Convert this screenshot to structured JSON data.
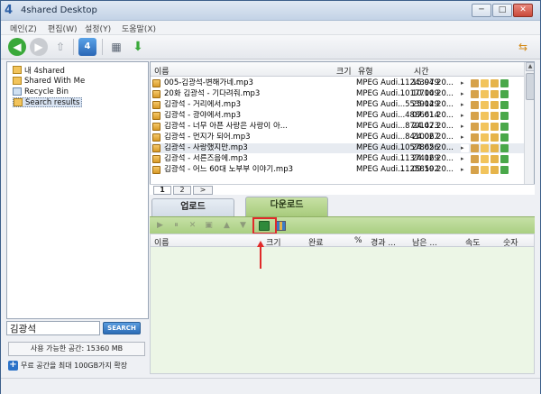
{
  "window": {
    "title": "4shared Desktop",
    "app_icon": "4",
    "controls": {
      "minimize": "─",
      "maximize": "□",
      "close": "✕"
    }
  },
  "menu": [
    "메인(Z)",
    "편집(W)",
    "설정(Y)",
    "도움말(X)"
  ],
  "toolbar": {
    "icons": [
      "back-icon",
      "forward-icon",
      "up-icon",
      "4shared-globe-icon",
      "view-icon",
      "download-arrow-icon",
      "sync-icon"
    ],
    "glyphs": {
      "back": "◀",
      "forward": "▶",
      "up": "⇧",
      "view": "▦",
      "download": "⬇",
      "sync": "⇆"
    }
  },
  "tree": {
    "items": [
      {
        "label": "내 4shared",
        "icon": "folder-icon"
      },
      {
        "label": "Shared With Me",
        "icon": "shared-folder-icon"
      },
      {
        "label": "Recycle Bin",
        "icon": "recycle-bin-icon"
      },
      {
        "label": "Search results",
        "icon": "search-results-icon",
        "selected": true
      }
    ]
  },
  "search": {
    "value": "김광석",
    "button_label": "SEARCH"
  },
  "storage": {
    "label": "사용 가능한 공간: 15360 MB"
  },
  "expand": {
    "label": "무료 공간을 최대 100GB가지 확장"
  },
  "results": {
    "columns": {
      "name": "이름",
      "size": "크기",
      "type": "유형",
      "time": "시간"
    },
    "rows": [
      {
        "name": "005-김광석-변해가네.mp3",
        "size": "11243979",
        "type": "MPEG Audi...",
        "time": "15.04.20..."
      },
      {
        "name": "20화 김광석 - 기다려줘.mp3",
        "size": "10177049",
        "type": "MPEG Audi...",
        "time": "10.10.20..."
      },
      {
        "name": "김광석 - 거리에서.mp3",
        "size": "5539129",
        "type": "MPEG Audi...",
        "time": "25.04.20..."
      },
      {
        "name": "김광석 - 광야에서.mp3",
        "size": "4886614",
        "type": "MPEG Audi...",
        "time": "07.01.20..."
      },
      {
        "name": "김광석 - 너무 아픈 사랑은 사랑이 아...",
        "size": "8701473",
        "type": "MPEG Audi...",
        "time": "24.02.20..."
      },
      {
        "name": "김광석 - 먼지가 되어.mp3",
        "size": "8410067",
        "type": "MPEG Audi...",
        "time": "24.02.20..."
      },
      {
        "name": "김광석 - 사랑했지만.mp3",
        "size": "10578656",
        "type": "MPEG Audi...",
        "time": "24.02.20...",
        "highlighted": true
      },
      {
        "name": "김광석 - 서른즈음에.mp3",
        "size": "11374169",
        "type": "MPEG Audi...",
        "time": "24.02.20..."
      },
      {
        "name": "김광석 - 어느 60대 노부부 이야기.mp3",
        "size": "11258592",
        "type": "MPEG Audi...",
        "time": "09.10.20..."
      }
    ],
    "action_icons": [
      "play-icon",
      "info-icon",
      "folder-action-icon",
      "share-icon",
      "download-icon"
    ]
  },
  "pager": {
    "pages": [
      "1",
      "2",
      ">"
    ]
  },
  "tabs": {
    "upload": "업로드",
    "download": "다운로드"
  },
  "download_toolbar": {
    "glyphs": {
      "play": "▶",
      "pause": "⏸",
      "cancel": "✕",
      "delete": "▣",
      "up": "▲",
      "down": "▼"
    },
    "icons": [
      "play-icon",
      "pause-icon",
      "cancel-icon",
      "delete-icon",
      "move-up-icon",
      "move-down-icon",
      "open-folder-icon",
      "settings-grid-icon"
    ]
  },
  "download_columns": {
    "name": "이름",
    "size": "크기",
    "done": "완료",
    "percent": "%",
    "elapsed": "경과 ...",
    "remaining": "남은 ...",
    "speed": "속도",
    "count": "숫자"
  },
  "colors": {
    "accent_green": "#a8cb7c",
    "search_button": "#2b6cb6",
    "highlight_red": "#e02a2a"
  }
}
